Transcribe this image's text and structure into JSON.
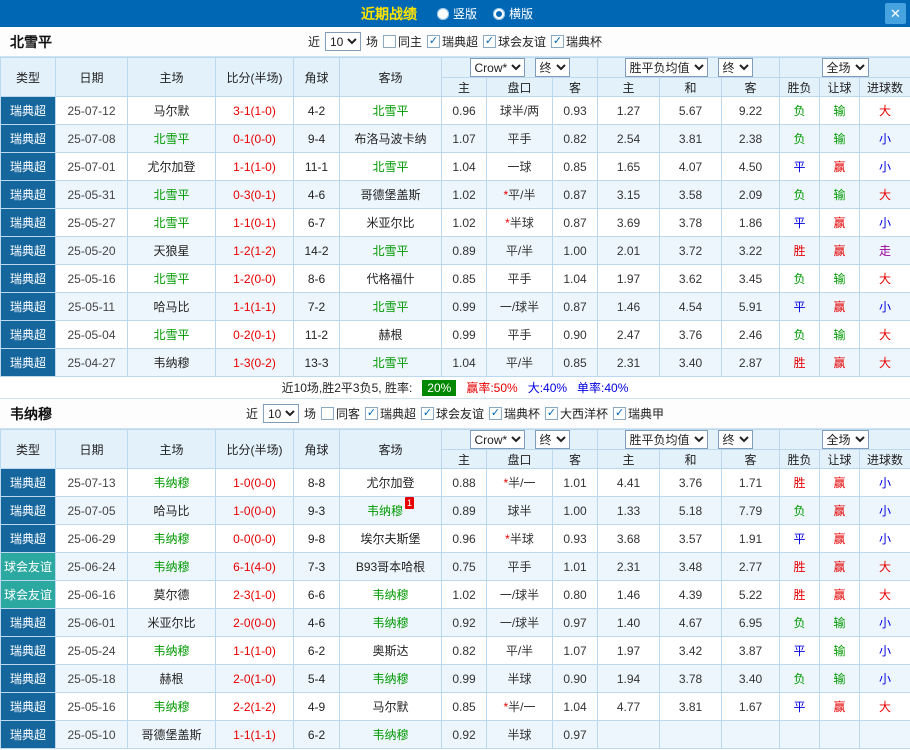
{
  "titlebar": {
    "title": "近期战绩",
    "radio_vertical": "竖版",
    "radio_horizontal": "横版",
    "close": "✕"
  },
  "colors": {
    "titlebar_bg": "#0067b4",
    "title_text": "#ffe400",
    "league_super_bg": "#15669d",
    "league_friendly_bg": "#2ba8a0",
    "focus_team_green": "#009900",
    "score_red": "#e60000",
    "draw_blue": "#0000e0",
    "walk_purple": "#990099",
    "win_rate_badge_bg": "#008800",
    "row_alt_bg": "#eef6fd",
    "table_border": "#bcd8ee"
  },
  "sections": [
    {
      "team": "北雪平",
      "filters": {
        "near_label": "近",
        "count": "10",
        "games_label": "场",
        "checkboxes": [
          {
            "label": "同主",
            "checked": false
          },
          {
            "label": "瑞典超",
            "checked": true
          },
          {
            "label": "球会友谊",
            "checked": true
          },
          {
            "label": "瑞典杯",
            "checked": true
          }
        ]
      },
      "header": {
        "col_type": "类型",
        "col_date": "日期",
        "col_home": "主场",
        "col_score": "比分(半场)",
        "col_corner": "角球",
        "col_away": "客场",
        "odds_select": "Crow*",
        "odds_final": "终",
        "avg_select": "胜平负均值",
        "avg_final": "终",
        "fullgame_select": "全场",
        "sub": [
          "主",
          "盘口",
          "客",
          "主",
          "和",
          "客",
          "胜负",
          "让球",
          "进球数"
        ]
      },
      "rows": [
        {
          "league": "瑞典超",
          "league_type": "super",
          "date": "25-07-12",
          "home": "马尔默",
          "home_focus": false,
          "score": "3-1(1-0)",
          "corner": "4-2",
          "away": "北雪平",
          "away_focus": true,
          "odds": [
            "0.96",
            "球半/两",
            "0.93"
          ],
          "avg": [
            "1.27",
            "5.67",
            "9.22"
          ],
          "results": [
            [
              "负",
              "green"
            ],
            [
              "输",
              "green"
            ],
            [
              "大",
              "red"
            ]
          ]
        },
        {
          "league": "瑞典超",
          "league_type": "super",
          "date": "25-07-08",
          "home": "北雪平",
          "home_focus": true,
          "score": "0-1(0-0)",
          "corner": "9-4",
          "away": "布洛马波卡纳",
          "away_focus": false,
          "odds": [
            "1.07",
            "平手",
            "0.82"
          ],
          "avg": [
            "2.54",
            "3.81",
            "2.38"
          ],
          "results": [
            [
              "负",
              "green"
            ],
            [
              "输",
              "green"
            ],
            [
              "小",
              "blue"
            ]
          ]
        },
        {
          "league": "瑞典超",
          "league_type": "super",
          "date": "25-07-01",
          "home": "尤尔加登",
          "home_focus": false,
          "score": "1-1(1-0)",
          "corner": "11-1",
          "away": "北雪平",
          "away_focus": true,
          "odds": [
            "1.04",
            "一球",
            "0.85"
          ],
          "avg": [
            "1.65",
            "4.07",
            "4.50"
          ],
          "results": [
            [
              "平",
              "blue"
            ],
            [
              "赢",
              "red"
            ],
            [
              "小",
              "blue"
            ]
          ]
        },
        {
          "league": "瑞典超",
          "league_type": "super",
          "date": "25-05-31",
          "home": "北雪平",
          "home_focus": true,
          "score": "0-3(0-1)",
          "corner": "4-6",
          "away": "哥德堡盖斯",
          "away_focus": false,
          "odds": [
            "1.02",
            "*平/半",
            "0.87"
          ],
          "avg": [
            "3.15",
            "3.58",
            "2.09"
          ],
          "results": [
            [
              "负",
              "green"
            ],
            [
              "输",
              "green"
            ],
            [
              "大",
              "red"
            ]
          ]
        },
        {
          "league": "瑞典超",
          "league_type": "super",
          "date": "25-05-27",
          "home": "北雪平",
          "home_focus": true,
          "score": "1-1(0-1)",
          "corner": "6-7",
          "away": "米亚尔比",
          "away_focus": false,
          "odds": [
            "1.02",
            "*半球",
            "0.87"
          ],
          "avg": [
            "3.69",
            "3.78",
            "1.86"
          ],
          "results": [
            [
              "平",
              "blue"
            ],
            [
              "赢",
              "red"
            ],
            [
              "小",
              "blue"
            ]
          ]
        },
        {
          "league": "瑞典超",
          "league_type": "super",
          "date": "25-05-20",
          "home": "天狼星",
          "home_focus": false,
          "score": "1-2(1-2)",
          "corner": "14-2",
          "away": "北雪平",
          "away_focus": true,
          "odds": [
            "0.89",
            "平/半",
            "1.00"
          ],
          "avg": [
            "2.01",
            "3.72",
            "3.22"
          ],
          "results": [
            [
              "胜",
              "red"
            ],
            [
              "赢",
              "red"
            ],
            [
              "走",
              "purple"
            ]
          ]
        },
        {
          "league": "瑞典超",
          "league_type": "super",
          "date": "25-05-16",
          "home": "北雪平",
          "home_focus": true,
          "score": "1-2(0-0)",
          "corner": "8-6",
          "away": "代格福什",
          "away_focus": false,
          "odds": [
            "0.85",
            "平手",
            "1.04"
          ],
          "avg": [
            "1.97",
            "3.62",
            "3.45"
          ],
          "results": [
            [
              "负",
              "green"
            ],
            [
              "输",
              "green"
            ],
            [
              "大",
              "red"
            ]
          ]
        },
        {
          "league": "瑞典超",
          "league_type": "super",
          "date": "25-05-11",
          "home": "哈马比",
          "home_focus": false,
          "score": "1-1(1-1)",
          "corner": "7-2",
          "away": "北雪平",
          "away_focus": true,
          "odds": [
            "0.99",
            "一/球半",
            "0.87"
          ],
          "avg": [
            "1.46",
            "4.54",
            "5.91"
          ],
          "results": [
            [
              "平",
              "blue"
            ],
            [
              "赢",
              "red"
            ],
            [
              "小",
              "blue"
            ]
          ]
        },
        {
          "league": "瑞典超",
          "league_type": "super",
          "date": "25-05-04",
          "home": "北雪平",
          "home_focus": true,
          "score": "0-2(0-1)",
          "corner": "11-2",
          "away": "赫根",
          "away_focus": false,
          "odds": [
            "0.99",
            "平手",
            "0.90"
          ],
          "avg": [
            "2.47",
            "3.76",
            "2.46"
          ],
          "results": [
            [
              "负",
              "green"
            ],
            [
              "输",
              "green"
            ],
            [
              "大",
              "red"
            ]
          ]
        },
        {
          "league": "瑞典超",
          "league_type": "super",
          "date": "25-04-27",
          "home": "韦纳穆",
          "home_focus": false,
          "score": "1-3(0-2)",
          "corner": "13-3",
          "away": "北雪平",
          "away_focus": true,
          "odds": [
            "1.04",
            "平/半",
            "0.85"
          ],
          "avg": [
            "2.31",
            "3.40",
            "2.87"
          ],
          "results": [
            [
              "胜",
              "red"
            ],
            [
              "赢",
              "red"
            ],
            [
              "大",
              "red"
            ]
          ]
        }
      ],
      "summary": {
        "prefix": "近10场,胜2平3负5, 胜率:",
        "win_rate": "20%",
        "parts": [
          {
            "text": "赢率:50%",
            "cls": "red"
          },
          {
            "text": "大:40%",
            "cls": "blue"
          },
          {
            "text": "单率:40%",
            "cls": "blue"
          }
        ]
      }
    },
    {
      "team": "韦纳穆",
      "filters": {
        "near_label": "近",
        "count": "10",
        "games_label": "场",
        "checkboxes": [
          {
            "label": "同客",
            "checked": false
          },
          {
            "label": "瑞典超",
            "checked": true
          },
          {
            "label": "球会友谊",
            "checked": true
          },
          {
            "label": "瑞典杯",
            "checked": true
          },
          {
            "label": "大西洋杯",
            "checked": true
          },
          {
            "label": "瑞典甲",
            "checked": true
          }
        ]
      },
      "header": {
        "col_type": "类型",
        "col_date": "日期",
        "col_home": "主场",
        "col_score": "比分(半场)",
        "col_corner": "角球",
        "col_away": "客场",
        "odds_select": "Crow*",
        "odds_final": "终",
        "avg_select": "胜平负均值",
        "avg_final": "终",
        "fullgame_select": "全场",
        "sub": [
          "主",
          "盘口",
          "客",
          "主",
          "和",
          "客",
          "胜负",
          "让球",
          "进球数"
        ]
      },
      "rows": [
        {
          "league": "瑞典超",
          "league_type": "super",
          "date": "25-07-13",
          "home": "韦纳穆",
          "home_focus": true,
          "score": "1-0(0-0)",
          "corner": "8-8",
          "away": "尤尔加登",
          "away_focus": false,
          "odds": [
            "0.88",
            "*半/一",
            "1.01"
          ],
          "avg": [
            "4.41",
            "3.76",
            "1.71"
          ],
          "results": [
            [
              "胜",
              "red"
            ],
            [
              "赢",
              "red"
            ],
            [
              "小",
              "blue"
            ]
          ]
        },
        {
          "league": "瑞典超",
          "league_type": "super",
          "date": "25-07-05",
          "home": "哈马比",
          "home_focus": false,
          "score": "1-0(0-0)",
          "corner": "9-3",
          "away": "韦纳穆",
          "away_focus": true,
          "away_badge": "1",
          "odds": [
            "0.89",
            "球半",
            "1.00"
          ],
          "avg": [
            "1.33",
            "5.18",
            "7.79"
          ],
          "results": [
            [
              "负",
              "green"
            ],
            [
              "赢",
              "red"
            ],
            [
              "小",
              "blue"
            ]
          ]
        },
        {
          "league": "瑞典超",
          "league_type": "super",
          "date": "25-06-29",
          "home": "韦纳穆",
          "home_focus": true,
          "score": "0-0(0-0)",
          "corner": "9-8",
          "away": "埃尔夫斯堡",
          "away_focus": false,
          "odds": [
            "0.96",
            "*半球",
            "0.93"
          ],
          "avg": [
            "3.68",
            "3.57",
            "1.91"
          ],
          "results": [
            [
              "平",
              "blue"
            ],
            [
              "赢",
              "red"
            ],
            [
              "小",
              "blue"
            ]
          ]
        },
        {
          "league": "球会友谊",
          "league_type": "friendly",
          "date": "25-06-24",
          "home": "韦纳穆",
          "home_focus": true,
          "score": "6-1(4-0)",
          "corner": "7-3",
          "away": "B93哥本哈根",
          "away_focus": false,
          "odds": [
            "0.75",
            "平手",
            "1.01"
          ],
          "avg": [
            "2.31",
            "3.48",
            "2.77"
          ],
          "results": [
            [
              "胜",
              "red"
            ],
            [
              "赢",
              "red"
            ],
            [
              "大",
              "red"
            ]
          ]
        },
        {
          "league": "球会友谊",
          "league_type": "friendly",
          "date": "25-06-16",
          "home": "莫尔德",
          "home_focus": false,
          "score": "2-3(1-0)",
          "corner": "6-6",
          "away": "韦纳穆",
          "away_focus": true,
          "odds": [
            "1.02",
            "一/球半",
            "0.80"
          ],
          "avg": [
            "1.46",
            "4.39",
            "5.22"
          ],
          "results": [
            [
              "胜",
              "red"
            ],
            [
              "赢",
              "red"
            ],
            [
              "大",
              "red"
            ]
          ]
        },
        {
          "league": "瑞典超",
          "league_type": "super",
          "date": "25-06-01",
          "home": "米亚尔比",
          "home_focus": false,
          "score": "2-0(0-0)",
          "corner": "4-6",
          "away": "韦纳穆",
          "away_focus": true,
          "odds": [
            "0.92",
            "一/球半",
            "0.97"
          ],
          "avg": [
            "1.40",
            "4.67",
            "6.95"
          ],
          "results": [
            [
              "负",
              "green"
            ],
            [
              "输",
              "green"
            ],
            [
              "小",
              "blue"
            ]
          ]
        },
        {
          "league": "瑞典超",
          "league_type": "super",
          "date": "25-05-24",
          "home": "韦纳穆",
          "home_focus": true,
          "score": "1-1(1-0)",
          "corner": "6-2",
          "away": "奥斯达",
          "away_focus": false,
          "odds": [
            "0.82",
            "平/半",
            "1.07"
          ],
          "avg": [
            "1.97",
            "3.42",
            "3.87"
          ],
          "results": [
            [
              "平",
              "blue"
            ],
            [
              "输",
              "green"
            ],
            [
              "小",
              "blue"
            ]
          ]
        },
        {
          "league": "瑞典超",
          "league_type": "super",
          "date": "25-05-18",
          "home": "赫根",
          "home_focus": false,
          "score": "2-0(1-0)",
          "corner": "5-4",
          "away": "韦纳穆",
          "away_focus": true,
          "odds": [
            "0.99",
            "半球",
            "0.90"
          ],
          "avg": [
            "1.94",
            "3.78",
            "3.40"
          ],
          "results": [
            [
              "负",
              "green"
            ],
            [
              "输",
              "green"
            ],
            [
              "小",
              "blue"
            ]
          ]
        },
        {
          "league": "瑞典超",
          "league_type": "super",
          "date": "25-05-16",
          "home": "韦纳穆",
          "home_focus": true,
          "score": "2-2(1-2)",
          "corner": "4-9",
          "away": "马尔默",
          "away_focus": false,
          "odds": [
            "0.85",
            "*半/一",
            "1.04"
          ],
          "avg": [
            "4.77",
            "3.81",
            "1.67"
          ],
          "results": [
            [
              "平",
              "blue"
            ],
            [
              "赢",
              "red"
            ],
            [
              "大",
              "red"
            ]
          ]
        },
        {
          "league": "瑞典超",
          "league_type": "super",
          "date": "25-05-10",
          "home": "哥德堡盖斯",
          "home_focus": false,
          "score": "1-1(1-1)",
          "corner": "6-2",
          "away": "韦纳穆",
          "away_focus": true,
          "odds": [
            "0.92",
            "半球",
            "0.97"
          ],
          "avg": [
            "",
            "",
            ""
          ],
          "results": [
            [
              "",
              ""
            ],
            [
              "",
              ""
            ],
            [
              "",
              ""
            ]
          ]
        }
      ]
    }
  ]
}
